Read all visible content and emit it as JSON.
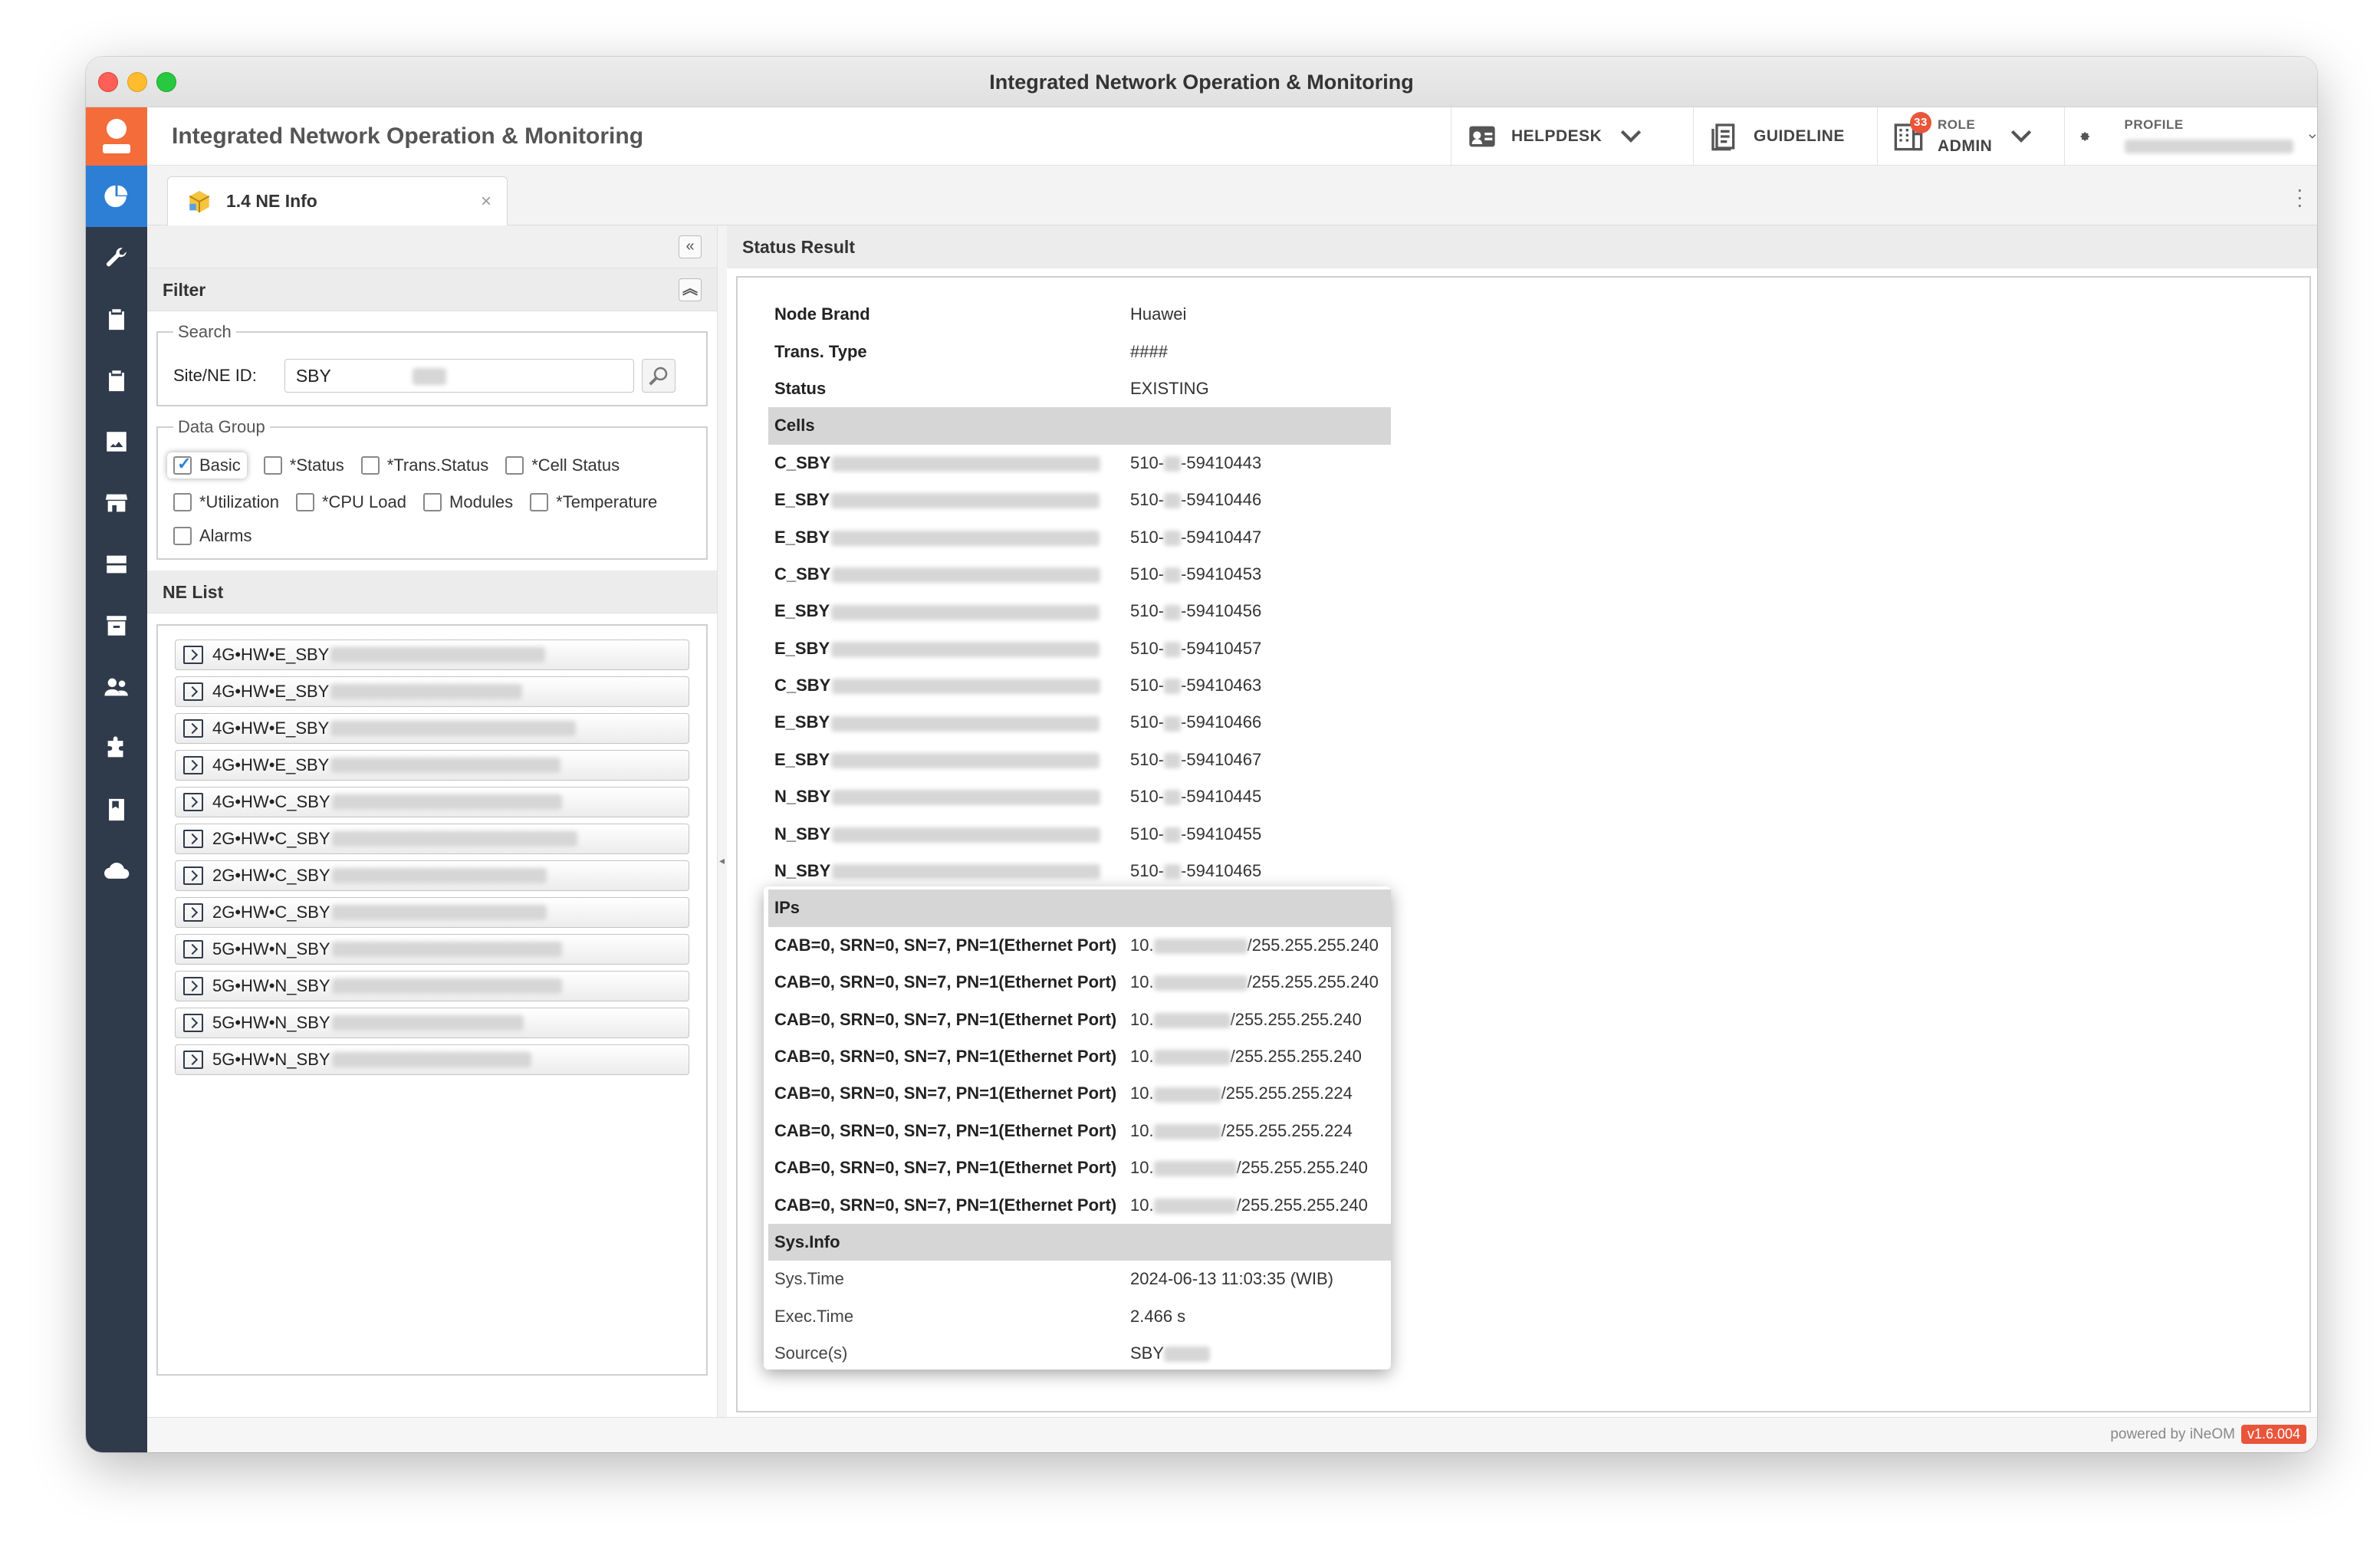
{
  "window": {
    "title": "Integrated Network Operation & Monitoring"
  },
  "header": {
    "app_title": "Integrated Network Operation & Monitoring",
    "helpdesk": "HELPDESK",
    "guideline": "GUIDELINE",
    "role_label": "ROLE",
    "role_value": "ADMIN",
    "role_badge": "33",
    "profile_label": "PROFILE"
  },
  "tab": {
    "label": "1.4 NE Info",
    "close": "×"
  },
  "filter": {
    "title": "Filter",
    "search_legend": "Search",
    "site_label": "Site/NE ID:",
    "site_value": "SBY",
    "data_group_legend": "Data Group",
    "options": [
      {
        "label": "Basic",
        "checked": true
      },
      {
        "label": "*Status",
        "checked": false
      },
      {
        "label": "*Trans.Status",
        "checked": false
      },
      {
        "label": "*Cell Status",
        "checked": false
      },
      {
        "label": "*Utilization",
        "checked": false
      },
      {
        "label": "*CPU Load",
        "checked": false
      },
      {
        "label": "Modules",
        "checked": false
      },
      {
        "label": "*Temperature",
        "checked": false
      },
      {
        "label": "Alarms",
        "checked": false
      }
    ]
  },
  "ne_list": {
    "title": "NE List",
    "items": [
      "4G•HW•E_SBY",
      "4G•HW•E_SBY",
      "4G•HW•E_SBY",
      "4G•HW•E_SBY",
      "4G•HW•C_SBY",
      "2G•HW•C_SBY",
      "2G•HW•C_SBY",
      "2G•HW•C_SBY",
      "5G•HW•N_SBY",
      "5G•HW•N_SBY",
      "5G•HW•N_SBY",
      "5G•HW•N_SBY"
    ]
  },
  "status": {
    "title": "Status Result",
    "basic": [
      {
        "k": "Node Brand",
        "v": "Huawei"
      },
      {
        "k": "Trans. Type",
        "v": "####"
      },
      {
        "k": "Status",
        "v": "EXISTING"
      }
    ],
    "cells_title": "Cells",
    "cells": [
      {
        "k": "C_SBY",
        "v1": "510-",
        "v2": "-59410443"
      },
      {
        "k": "E_SBY",
        "v1": "510-",
        "v2": "-59410446"
      },
      {
        "k": "E_SBY",
        "v1": "510-",
        "v2": "-59410447"
      },
      {
        "k": "C_SBY",
        "v1": "510-",
        "v2": "-59410453"
      },
      {
        "k": "E_SBY",
        "v1": "510-",
        "v2": "-59410456"
      },
      {
        "k": "E_SBY",
        "v1": "510-",
        "v2": "-59410457"
      },
      {
        "k": "C_SBY",
        "v1": "510-",
        "v2": "-59410463"
      },
      {
        "k": "E_SBY",
        "v1": "510-",
        "v2": "-59410466"
      },
      {
        "k": "E_SBY",
        "v1": "510-",
        "v2": "-59410467"
      },
      {
        "k": "N_SBY",
        "v1": "510-",
        "v2": "-59410445"
      },
      {
        "k": "N_SBY",
        "v1": "510-",
        "v2": "-59410455"
      },
      {
        "k": "N_SBY",
        "v1": "510-",
        "v2": "-59410465"
      }
    ],
    "ips_title": "IPs",
    "ips": [
      {
        "k": "CAB=0, SRN=0, SN=7, PN=1(Ethernet Port)",
        "v1": "10.",
        "v2": "/255.255.255.240"
      },
      {
        "k": "CAB=0, SRN=0, SN=7, PN=1(Ethernet Port)",
        "v1": "10.",
        "v2": "/255.255.255.240"
      },
      {
        "k": "CAB=0, SRN=0, SN=7, PN=1(Ethernet Port)",
        "v1": "10.",
        "v2": "/255.255.255.240"
      },
      {
        "k": "CAB=0, SRN=0, SN=7, PN=1(Ethernet Port)",
        "v1": "10.",
        "v2": "/255.255.255.240"
      },
      {
        "k": "CAB=0, SRN=0, SN=7, PN=1(Ethernet Port)",
        "v1": "10.",
        "v2": "/255.255.255.224"
      },
      {
        "k": "CAB=0, SRN=0, SN=7, PN=1(Ethernet Port)",
        "v1": "10.",
        "v2": "/255.255.255.224"
      },
      {
        "k": "CAB=0, SRN=0, SN=7, PN=1(Ethernet Port)",
        "v1": "10.",
        "v2": "/255.255.255.240"
      },
      {
        "k": "CAB=0, SRN=0, SN=7, PN=1(Ethernet Port)",
        "v1": "10.",
        "v2": "/255.255.255.240"
      }
    ],
    "sys_title": "Sys.Info",
    "sys": [
      {
        "k": "Sys.Time",
        "v": "2024-06-13 11:03:35 (WIB)"
      },
      {
        "k": "Exec.Time",
        "v": "2.466 s"
      },
      {
        "k": "Source(s)",
        "v": "SBY"
      }
    ]
  },
  "footer": {
    "powered": "powered by iNeOM",
    "version": "v1.6.004"
  },
  "colors": {
    "sidebar": "#2f3a4b",
    "accent": "#2d7fd6",
    "brand": "#f36c3a",
    "badge": "#e9553a"
  }
}
